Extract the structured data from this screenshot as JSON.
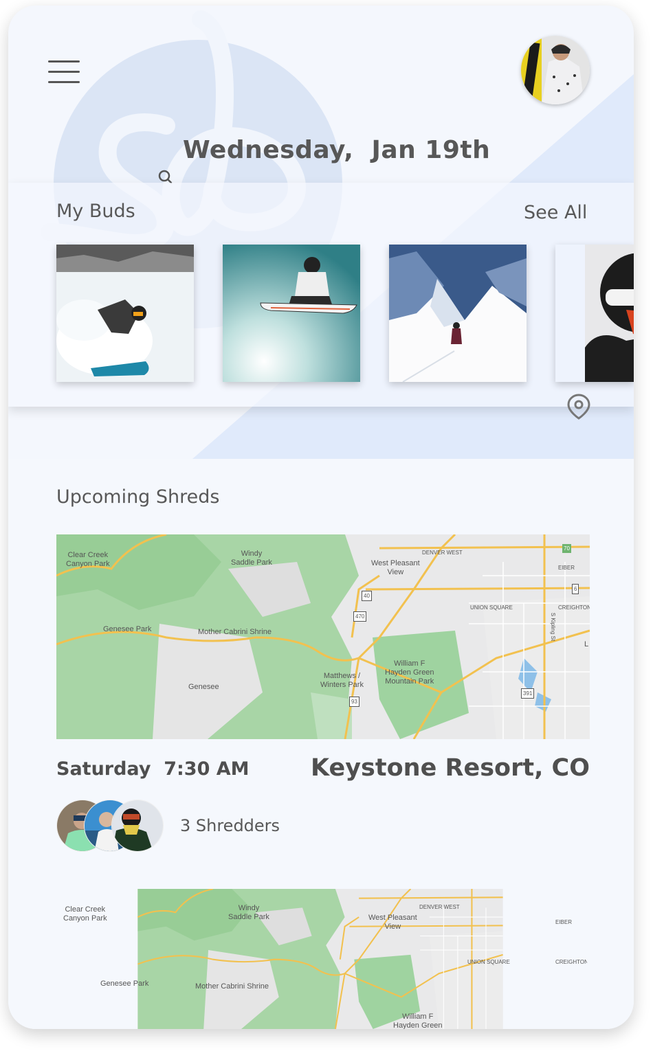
{
  "header": {
    "menu_icon": "hamburger-menu-icon",
    "avatar_icon": "user-avatar",
    "search_icon": "search-icon",
    "date_text": "Wednesday,  Jan 19th"
  },
  "buds": {
    "title": "My Buds",
    "see_all_label": "See All",
    "items": [
      {
        "name": "bud-photo-1",
        "desc": "snowboarder carving powder"
      },
      {
        "name": "bud-photo-2",
        "desc": "snowboarder mid-air jump"
      },
      {
        "name": "bud-photo-3",
        "desc": "snowboarder on mountain slope"
      },
      {
        "name": "bud-photo-4",
        "desc": "rider with helmet and goggles"
      }
    ],
    "pin_icon": "location-pin-icon"
  },
  "upcoming": {
    "title": "Upcoming Shreds",
    "events": [
      {
        "day_time": "Saturday  7:30 AM",
        "place": "Keystone Resort, CO",
        "shredders_label": "3 Shredders",
        "shredder_count": 3
      }
    ]
  },
  "map": {
    "labels": {
      "clear_creek": "Clear Creek\nCanyon Park",
      "windy_saddle": "Windy\nSaddle Park",
      "west_pleasant": "West Pleasant\nView",
      "denver_west": "DENVER WEST",
      "eiber": "EIBER",
      "union_square": "UNION SQUARE",
      "creighton": "CREIGHTON",
      "genesee_park": "Genesee Park",
      "mother_cabrini": "Mother Cabrini Shrine",
      "genesee": "Genesee",
      "matthews": "Matthews /\nWinters Park",
      "william_hayden": "William F\nHayden Green\nMountain Park",
      "william_hayden_short": "William F\nHayden Green",
      "kipling": "S Kipling St",
      "shield_70": "70",
      "shield_40": "40",
      "shield_470": "470",
      "shield_93": "93",
      "shield_391": "391",
      "shield_6": "6",
      "edge_l": "L"
    }
  },
  "colors": {
    "background": "#f4f7fd",
    "accent_blob": "#dfe8f7",
    "text": "#575757",
    "map_green": "#9fd3a0",
    "map_road": "#f6c95c"
  }
}
